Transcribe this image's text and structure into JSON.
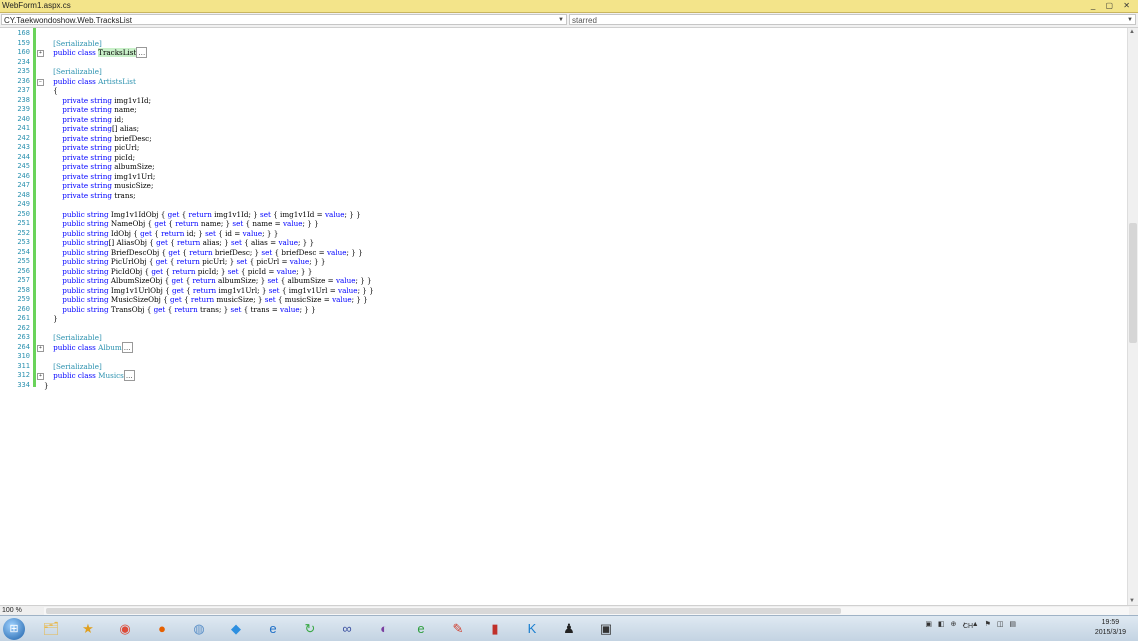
{
  "window": {
    "tab_title": "WebForm1.aspx.cs",
    "controls": "_ ▢ ✕"
  },
  "navbar": {
    "type_combo": "CY.Taekwondoshow.Web.TracksList",
    "member_combo": "starred"
  },
  "editor": {
    "lines": [
      {
        "num": "168",
        "segments": []
      },
      {
        "num": "159",
        "segments": [
          {
            "t": "    "
          },
          {
            "t": "[Serializable]",
            "c": "attr"
          }
        ]
      },
      {
        "num": "160",
        "fold": "+",
        "segments": [
          {
            "t": "    "
          },
          {
            "t": "public class ",
            "c": "kw"
          },
          {
            "t": "TracksList",
            "c": "hl"
          },
          {
            "t": "...",
            "c": "collapsed"
          }
        ]
      },
      {
        "num": "234",
        "segments": []
      },
      {
        "num": "235",
        "segments": [
          {
            "t": "    "
          },
          {
            "t": "[Serializable]",
            "c": "attr"
          }
        ]
      },
      {
        "num": "236",
        "fold": "−",
        "segments": [
          {
            "t": "    "
          },
          {
            "t": "public class ",
            "c": "kw"
          },
          {
            "t": "ArtistsList",
            "c": "attr"
          }
        ]
      },
      {
        "num": "237",
        "segments": [
          {
            "t": "    {"
          }
        ]
      },
      {
        "num": "238",
        "segments": [
          {
            "t": "        "
          },
          {
            "t": "private string ",
            "c": "kw"
          },
          {
            "t": "img1v1Id;"
          }
        ]
      },
      {
        "num": "239",
        "segments": [
          {
            "t": "        "
          },
          {
            "t": "private string ",
            "c": "kw"
          },
          {
            "t": "name;"
          }
        ]
      },
      {
        "num": "240",
        "segments": [
          {
            "t": "        "
          },
          {
            "t": "private string ",
            "c": "kw"
          },
          {
            "t": "id;"
          }
        ]
      },
      {
        "num": "241",
        "segments": [
          {
            "t": "        "
          },
          {
            "t": "private string",
            "c": "kw"
          },
          {
            "t": "[] alias;"
          }
        ]
      },
      {
        "num": "242",
        "segments": [
          {
            "t": "        "
          },
          {
            "t": "private string ",
            "c": "kw"
          },
          {
            "t": "briefDesc;"
          }
        ]
      },
      {
        "num": "243",
        "segments": [
          {
            "t": "        "
          },
          {
            "t": "private string ",
            "c": "kw"
          },
          {
            "t": "picUrl;"
          }
        ]
      },
      {
        "num": "244",
        "segments": [
          {
            "t": "        "
          },
          {
            "t": "private string ",
            "c": "kw"
          },
          {
            "t": "picId;"
          }
        ]
      },
      {
        "num": "245",
        "segments": [
          {
            "t": "        "
          },
          {
            "t": "private string ",
            "c": "kw"
          },
          {
            "t": "albumSize;"
          }
        ]
      },
      {
        "num": "246",
        "segments": [
          {
            "t": "        "
          },
          {
            "t": "private string ",
            "c": "kw"
          },
          {
            "t": "img1v1Url;"
          }
        ]
      },
      {
        "num": "247",
        "segments": [
          {
            "t": "        "
          },
          {
            "t": "private string ",
            "c": "kw"
          },
          {
            "t": "musicSize;"
          }
        ]
      },
      {
        "num": "248",
        "segments": [
          {
            "t": "        "
          },
          {
            "t": "private string ",
            "c": "kw"
          },
          {
            "t": "trans;"
          }
        ]
      },
      {
        "num": "249",
        "segments": []
      },
      {
        "num": "250",
        "segments": [
          {
            "t": "        "
          },
          {
            "t": "public string ",
            "c": "kw"
          },
          {
            "t": "Img1v1IdObj { "
          },
          {
            "t": "get",
            "c": "kw"
          },
          {
            "t": " { "
          },
          {
            "t": "return",
            "c": "kw"
          },
          {
            "t": " img1v1Id; } "
          },
          {
            "t": "set",
            "c": "kw"
          },
          {
            "t": " { img1v1Id = "
          },
          {
            "t": "value",
            "c": "kw"
          },
          {
            "t": "; } }"
          }
        ]
      },
      {
        "num": "251",
        "segments": [
          {
            "t": "        "
          },
          {
            "t": "public string ",
            "c": "kw"
          },
          {
            "t": "NameObj { "
          },
          {
            "t": "get",
            "c": "kw"
          },
          {
            "t": " { "
          },
          {
            "t": "return",
            "c": "kw"
          },
          {
            "t": " name; } "
          },
          {
            "t": "set",
            "c": "kw"
          },
          {
            "t": " { name = "
          },
          {
            "t": "value",
            "c": "kw"
          },
          {
            "t": "; } }"
          }
        ]
      },
      {
        "num": "252",
        "segments": [
          {
            "t": "        "
          },
          {
            "t": "public string ",
            "c": "kw"
          },
          {
            "t": "IdObj { "
          },
          {
            "t": "get",
            "c": "kw"
          },
          {
            "t": " { "
          },
          {
            "t": "return",
            "c": "kw"
          },
          {
            "t": " id; } "
          },
          {
            "t": "set",
            "c": "kw"
          },
          {
            "t": " { id = "
          },
          {
            "t": "value",
            "c": "kw"
          },
          {
            "t": "; } }"
          }
        ]
      },
      {
        "num": "253",
        "segments": [
          {
            "t": "        "
          },
          {
            "t": "public string",
            "c": "kw"
          },
          {
            "t": "[] AliasObj { "
          },
          {
            "t": "get",
            "c": "kw"
          },
          {
            "t": " { "
          },
          {
            "t": "return",
            "c": "kw"
          },
          {
            "t": " alias; } "
          },
          {
            "t": "set",
            "c": "kw"
          },
          {
            "t": " { alias = "
          },
          {
            "t": "value",
            "c": "kw"
          },
          {
            "t": "; } }"
          }
        ]
      },
      {
        "num": "254",
        "segments": [
          {
            "t": "        "
          },
          {
            "t": "public string ",
            "c": "kw"
          },
          {
            "t": "BriefDescObj { "
          },
          {
            "t": "get",
            "c": "kw"
          },
          {
            "t": " { "
          },
          {
            "t": "return",
            "c": "kw"
          },
          {
            "t": " briefDesc; } "
          },
          {
            "t": "set",
            "c": "kw"
          },
          {
            "t": " { briefDesc = "
          },
          {
            "t": "value",
            "c": "kw"
          },
          {
            "t": "; } }"
          }
        ]
      },
      {
        "num": "255",
        "segments": [
          {
            "t": "        "
          },
          {
            "t": "public string ",
            "c": "kw"
          },
          {
            "t": "PicUrlObj { "
          },
          {
            "t": "get",
            "c": "kw"
          },
          {
            "t": " { "
          },
          {
            "t": "return",
            "c": "kw"
          },
          {
            "t": " picUrl; } "
          },
          {
            "t": "set",
            "c": "kw"
          },
          {
            "t": " { picUrl = "
          },
          {
            "t": "value",
            "c": "kw"
          },
          {
            "t": "; } }"
          }
        ]
      },
      {
        "num": "256",
        "segments": [
          {
            "t": "        "
          },
          {
            "t": "public string ",
            "c": "kw"
          },
          {
            "t": "PicIdObj { "
          },
          {
            "t": "get",
            "c": "kw"
          },
          {
            "t": " { "
          },
          {
            "t": "return",
            "c": "kw"
          },
          {
            "t": " picId; } "
          },
          {
            "t": "set",
            "c": "kw"
          },
          {
            "t": " { picId = "
          },
          {
            "t": "value",
            "c": "kw"
          },
          {
            "t": "; } }"
          }
        ]
      },
      {
        "num": "257",
        "segments": [
          {
            "t": "        "
          },
          {
            "t": "public string ",
            "c": "kw"
          },
          {
            "t": "AlbumSizeObj { "
          },
          {
            "t": "get",
            "c": "kw"
          },
          {
            "t": " { "
          },
          {
            "t": "return",
            "c": "kw"
          },
          {
            "t": " albumSize; } "
          },
          {
            "t": "set",
            "c": "kw"
          },
          {
            "t": " { albumSize = "
          },
          {
            "t": "value",
            "c": "kw"
          },
          {
            "t": "; } }"
          }
        ]
      },
      {
        "num": "258",
        "segments": [
          {
            "t": "        "
          },
          {
            "t": "public string ",
            "c": "kw"
          },
          {
            "t": "Img1v1UrlObj { "
          },
          {
            "t": "get",
            "c": "kw"
          },
          {
            "t": " { "
          },
          {
            "t": "return",
            "c": "kw"
          },
          {
            "t": " img1v1Url; } "
          },
          {
            "t": "set",
            "c": "kw"
          },
          {
            "t": " { img1v1Url = "
          },
          {
            "t": "value",
            "c": "kw"
          },
          {
            "t": "; } }"
          }
        ]
      },
      {
        "num": "259",
        "segments": [
          {
            "t": "        "
          },
          {
            "t": "public string ",
            "c": "kw"
          },
          {
            "t": "MusicSizeObj { "
          },
          {
            "t": "get",
            "c": "kw"
          },
          {
            "t": " { "
          },
          {
            "t": "return",
            "c": "kw"
          },
          {
            "t": " musicSize; } "
          },
          {
            "t": "set",
            "c": "kw"
          },
          {
            "t": " { musicSize = "
          },
          {
            "t": "value",
            "c": "kw"
          },
          {
            "t": "; } }"
          }
        ]
      },
      {
        "num": "260",
        "segments": [
          {
            "t": "        "
          },
          {
            "t": "public string ",
            "c": "kw"
          },
          {
            "t": "TransObj { "
          },
          {
            "t": "get",
            "c": "kw"
          },
          {
            "t": " { "
          },
          {
            "t": "return",
            "c": "kw"
          },
          {
            "t": " trans; } "
          },
          {
            "t": "set",
            "c": "kw"
          },
          {
            "t": " { trans = "
          },
          {
            "t": "value",
            "c": "kw"
          },
          {
            "t": "; } }"
          }
        ]
      },
      {
        "num": "261",
        "segments": [
          {
            "t": "    }"
          }
        ]
      },
      {
        "num": "262",
        "segments": []
      },
      {
        "num": "263",
        "segments": [
          {
            "t": "    "
          },
          {
            "t": "[Serializable]",
            "c": "attr"
          }
        ]
      },
      {
        "num": "264",
        "fold": "+",
        "segments": [
          {
            "t": "    "
          },
          {
            "t": "public class ",
            "c": "kw"
          },
          {
            "t": "Album",
            "c": "attr"
          },
          {
            "t": "...",
            "c": "collapsed"
          }
        ]
      },
      {
        "num": "310",
        "segments": []
      },
      {
        "num": "311",
        "segments": [
          {
            "t": "    "
          },
          {
            "t": "[Serializable]",
            "c": "attr"
          }
        ]
      },
      {
        "num": "312",
        "fold": "+",
        "segments": [
          {
            "t": "    "
          },
          {
            "t": "public class ",
            "c": "kw"
          },
          {
            "t": "Musics",
            "c": "attr"
          },
          {
            "t": "...",
            "c": "collapsed"
          }
        ]
      },
      {
        "num": "334",
        "segments": [
          {
            "t": "}"
          }
        ]
      }
    ]
  },
  "statusbar": {
    "zoom": "100 %"
  },
  "taskbar": {
    "icons": [
      {
        "name": "explorer-icon",
        "glyph": "🗂",
        "color": "#e8b84a"
      },
      {
        "name": "badge-app-icon",
        "glyph": "★",
        "color": "#e0a020"
      },
      {
        "name": "chrome-icon",
        "glyph": "◉",
        "color": "#dd4b39"
      },
      {
        "name": "firefox-icon",
        "glyph": "●",
        "color": "#e66000"
      },
      {
        "name": "browser-icon",
        "glyph": "◍",
        "color": "#5a8fc7"
      },
      {
        "name": "app-icon",
        "glyph": "◆",
        "color": "#2d8fe0"
      },
      {
        "name": "ie-icon",
        "glyph": "e",
        "color": "#1e6fc7"
      },
      {
        "name": "refresh-app-icon",
        "glyph": "↻",
        "color": "#39a845"
      },
      {
        "name": "link-app-icon",
        "glyph": "∞",
        "color": "#3a4fa0"
      },
      {
        "name": "media-icon",
        "glyph": "◐",
        "color": "#7a3fa0"
      },
      {
        "name": "ie2-icon",
        "glyph": "e",
        "color": "#2e9e3e"
      },
      {
        "name": "tool-icon",
        "glyph": "✎",
        "color": "#d04030"
      },
      {
        "name": "book-icon",
        "glyph": "▮",
        "color": "#c0302a"
      },
      {
        "name": "k-app-icon",
        "glyph": "K",
        "color": "#1a7fd0"
      },
      {
        "name": "qq-icon",
        "glyph": "♟",
        "color": "#222222"
      },
      {
        "name": "vs-icon",
        "glyph": "▣",
        "color": "#333333"
      }
    ],
    "language": "CH",
    "tray_icons": "▣ ◧ ⊕ ♪ ▲ ⚑ ◫ ▤",
    "time": "19:59",
    "date": "2015/3/19"
  }
}
